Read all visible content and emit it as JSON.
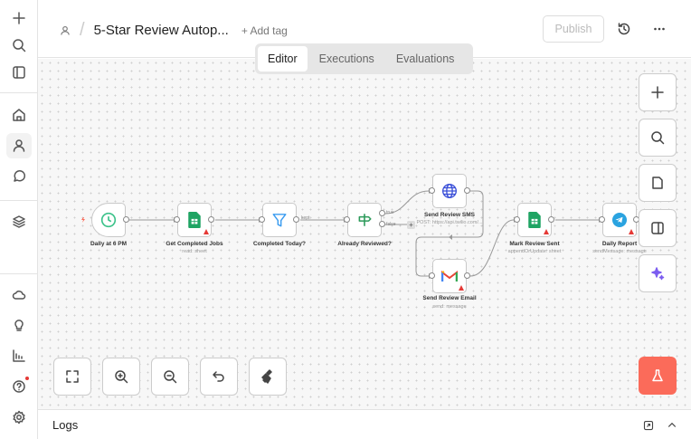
{
  "header": {
    "title": "5-Star Review Autop...",
    "add_tag": "+ Add tag",
    "publish": "Publish"
  },
  "tabs": [
    {
      "label": "Editor",
      "active": true
    },
    {
      "label": "Executions",
      "active": false
    },
    {
      "label": "Evaluations",
      "active": false
    }
  ],
  "nodes": [
    {
      "label": "Daily at 6 PM",
      "sub": "",
      "icon": "clock-icon"
    },
    {
      "label": "Get Completed Jobs",
      "sub": "read: sheet",
      "icon": "google-sheets-icon",
      "warning": true
    },
    {
      "label": "Completed Today?",
      "sub": "",
      "icon": "filter-icon"
    },
    {
      "label": "Already Reviewed?",
      "sub": "",
      "icon": "signpost-icon"
    },
    {
      "label": "Send Review SMS",
      "sub": "POST: https://api.twilio.com/...",
      "icon": "globe-icon"
    },
    {
      "label": "Send Review Email",
      "sub": "send: message",
      "icon": "gmail-icon",
      "warning": true
    },
    {
      "label": "Mark Review Sent",
      "sub": "appendOrUpdate: sheet",
      "icon": "google-sheets-icon",
      "warning": true
    },
    {
      "label": "Daily Report",
      "sub": "sendMessage: message",
      "icon": "telegram-icon",
      "warning": true
    }
  ],
  "ports": {
    "kept": "kept",
    "true": "true",
    "false": "false"
  },
  "logs": {
    "label": "Logs"
  },
  "colors": {
    "accent": "#fb6b5a",
    "warning": "#e53935",
    "notification": "#e53935"
  }
}
